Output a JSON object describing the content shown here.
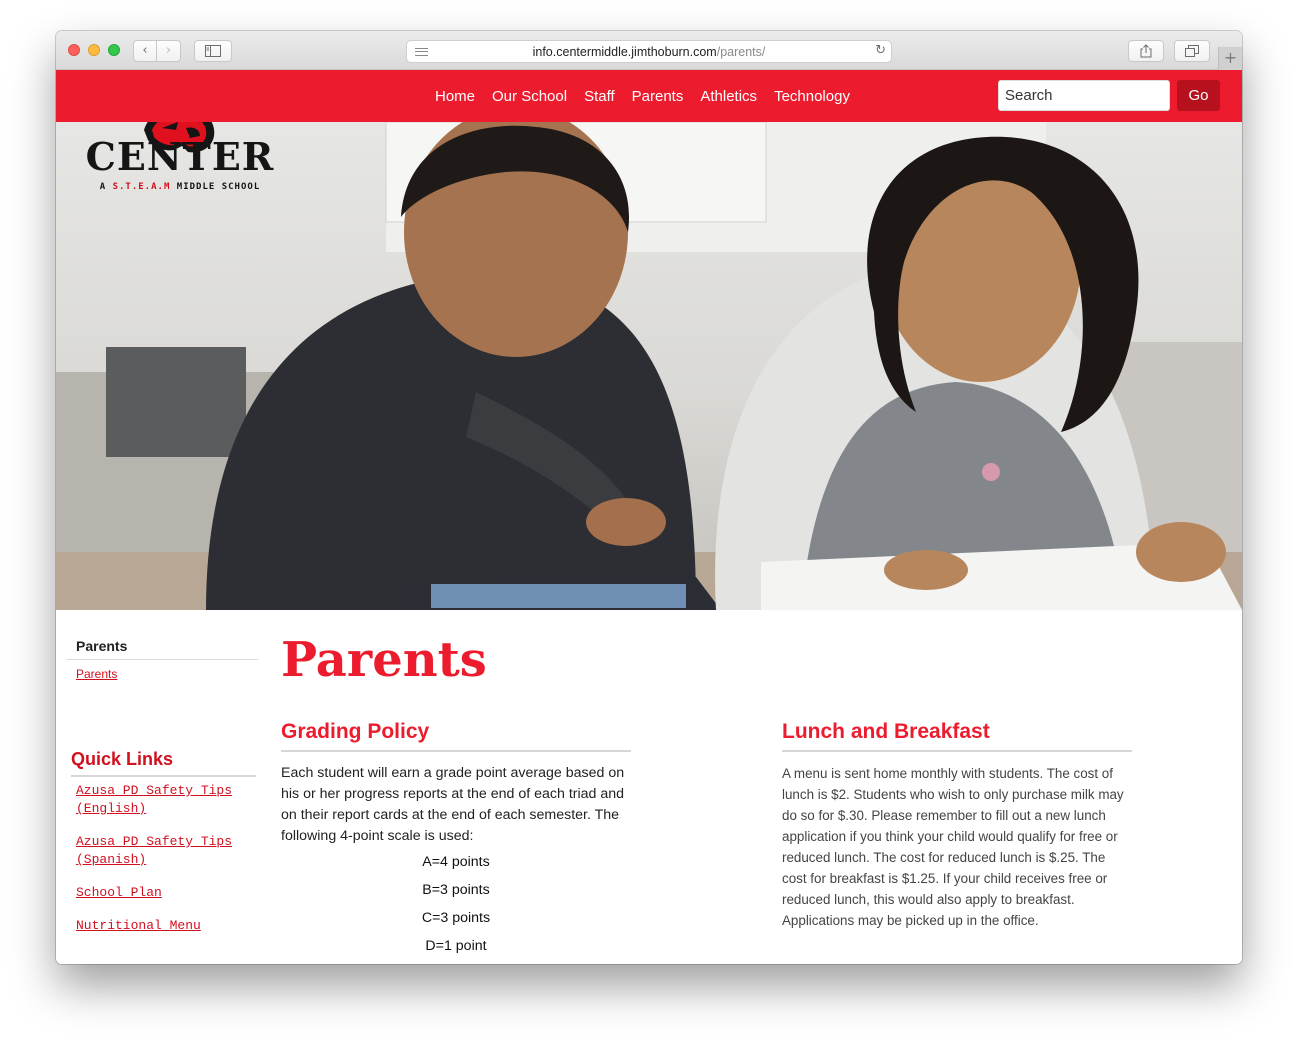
{
  "browser": {
    "url_domain": "info.centermiddle.jimthoburn.com",
    "url_path": "/parents/"
  },
  "header": {
    "nav": [
      "Home",
      "Our School",
      "Staff",
      "Parents",
      "Athletics",
      "Technology"
    ],
    "search_placeholder": "Search",
    "go_label": "Go",
    "brand_color": "#ec1c2e"
  },
  "logo": {
    "name": "CENTER",
    "tagline_prefix": "A ",
    "tagline_steam": "S.T.E.A.M",
    "tagline_suffix": " MIDDLE SCHOOL"
  },
  "sidebar": {
    "section_title": "Parents",
    "section_link": "Parents",
    "quick_links_title": "Quick Links",
    "quick_links": [
      "Azusa PD Safety Tips (English)",
      "Azusa PD Safety Tips (Spanish)",
      "School Plan",
      "Nutritional Menu"
    ]
  },
  "main": {
    "title": "Parents",
    "grading": {
      "heading": "Grading Policy",
      "body": "Each student will earn a grade point average based on his or her progress reports at the end of each triad and on their report cards at the end of each semester. The following 4-point scale is used:",
      "scale": [
        "A=4 points",
        "B=3 points",
        "C=3 points",
        "D=1 point"
      ]
    },
    "lunch": {
      "heading": "Lunch and Breakfast",
      "body": "A menu is sent home monthly with students. The cost of lunch is $2. Students who wish to only purchase milk may do so for $.30. Please remember to fill out a new lunch application if you think your child would qualify for free or reduced lunch. The cost for reduced lunch is $.25. The cost for breakfast is $1.25. If your child receives free or reduced lunch, this would also apply to breakfast. Applications may be picked up in the office."
    }
  }
}
